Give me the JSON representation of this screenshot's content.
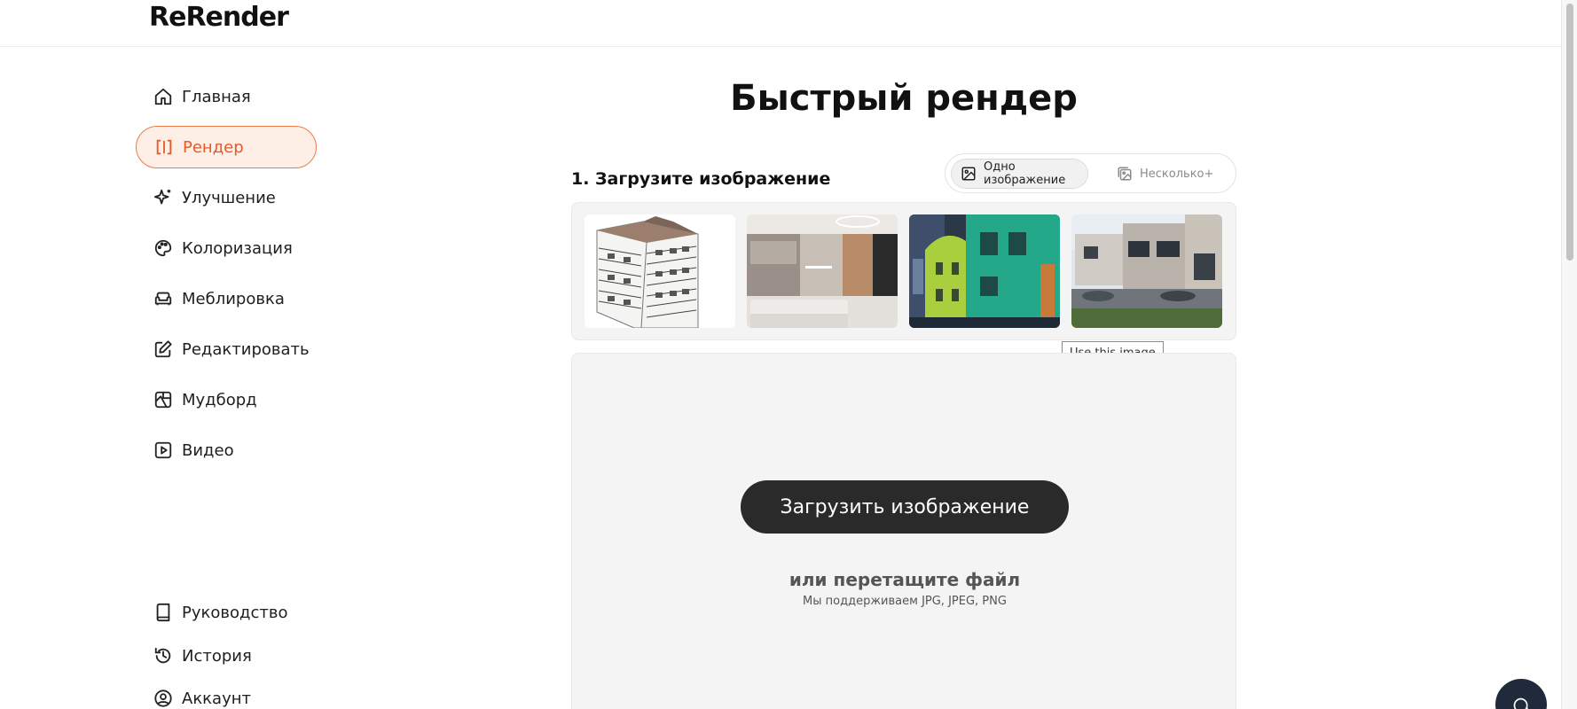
{
  "app": {
    "logo": "ReRender"
  },
  "sidebar": {
    "items": [
      {
        "label": "Главная",
        "icon": "home-icon"
      },
      {
        "label": "Рендер",
        "icon": "render-icon",
        "active": true
      },
      {
        "label": "Улучшение",
        "icon": "sparkle-icon"
      },
      {
        "label": "Колоризация",
        "icon": "palette-icon"
      },
      {
        "label": "Меблировка",
        "icon": "sofa-icon"
      },
      {
        "label": "Редактировать",
        "icon": "edit-icon"
      },
      {
        "label": "Мудборд",
        "icon": "moodboard-icon"
      },
      {
        "label": "Видео",
        "icon": "video-icon"
      }
    ],
    "bottom_items": [
      {
        "label": "Руководство",
        "icon": "book-icon"
      },
      {
        "label": "История",
        "icon": "history-icon"
      },
      {
        "label": "Аккаунт",
        "icon": "account-icon"
      }
    ]
  },
  "main": {
    "title": "Быстрый рендер",
    "section_title": "1. Загрузите изображение",
    "toggle": {
      "single_label": "Одно изображение",
      "multi_label": "Несколько+",
      "selected": "single"
    },
    "samples": {
      "tooltip": "Use this image",
      "count": 4
    },
    "dropzone": {
      "upload_button": "Загрузить изображение",
      "drop_text": "или перетащите файл",
      "formats_text": "Мы поддерживаем JPG, JPEG, PNG"
    }
  },
  "colors": {
    "accent": "#e8592a",
    "accent_bg": "#fdeee6",
    "button_dark": "#2a2a2a",
    "chat_button": "#202a3a"
  }
}
